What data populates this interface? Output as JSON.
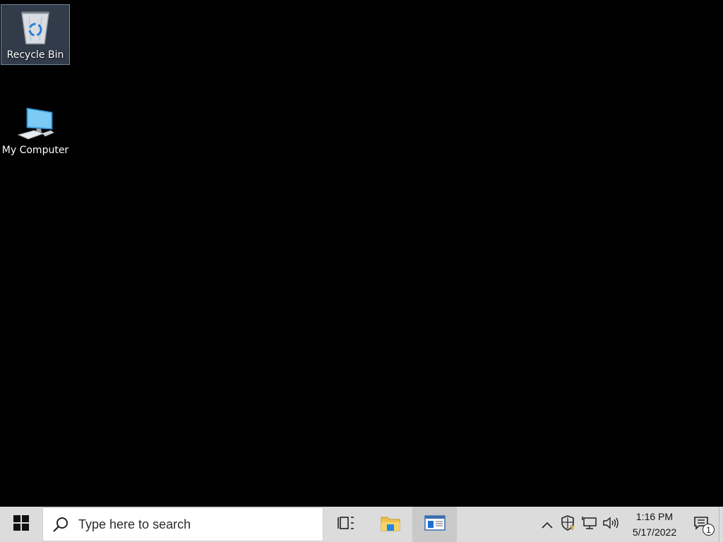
{
  "desktop": {
    "background": "#000000",
    "icons": [
      {
        "label": "Recycle Bin",
        "icon": "recycle-bin-icon",
        "selected": true
      },
      {
        "label": "My Computer",
        "icon": "computer-icon",
        "selected": false
      }
    ]
  },
  "taskbar": {
    "background": "#dcdcdc",
    "start_icon": "windows-logo-icon",
    "search": {
      "placeholder": "Type here to search",
      "icon": "search-icon"
    },
    "buttons": [
      {
        "icon": "task-view-icon"
      },
      {
        "icon": "file-explorer-icon"
      },
      {
        "icon": "app-window-icon",
        "active": true
      }
    ],
    "tray": {
      "icons": [
        "chevron-up-icon",
        "security-shield-icon",
        "network-icon",
        "volume-icon"
      ],
      "time": "1:16 PM",
      "date": "5/17/2022",
      "notification_count": "1"
    }
  },
  "colors": {
    "accent_blue": "#1e88e5",
    "folder_yellow": "#f2c14e"
  }
}
